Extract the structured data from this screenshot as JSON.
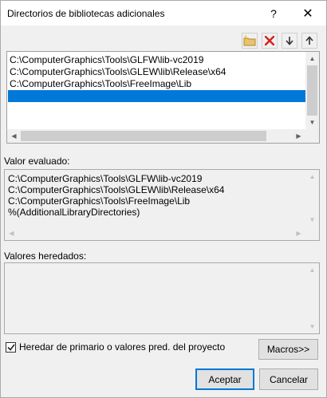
{
  "window": {
    "title": "Directorios de bibliotecas adicionales",
    "help_glyph": "?",
    "close_glyph": "✕"
  },
  "toolbar": {
    "icons": [
      "new-folder-icon",
      "delete-icon",
      "move-down-icon",
      "move-up-icon"
    ]
  },
  "list": {
    "items": [
      "C:\\ComputerGraphics\\Tools\\GLFW\\lib-vc2019",
      "C:\\ComputerGraphics\\Tools\\GLEW\\lib\\Release\\x64",
      "C:\\ComputerGraphics\\Tools\\FreeImage\\Lib",
      ""
    ],
    "selected_index": 3
  },
  "evaluated": {
    "label": "Valor evaluado:",
    "lines": [
      "C:\\ComputerGraphics\\Tools\\GLFW\\lib-vc2019",
      "C:\\ComputerGraphics\\Tools\\GLEW\\lib\\Release\\x64",
      "C:\\ComputerGraphics\\Tools\\FreeImage\\Lib",
      "%(AdditionalLibraryDirectories)"
    ]
  },
  "inherited": {
    "label": "Valores heredados:",
    "lines": []
  },
  "inherit_checkbox": {
    "label": "Heredar de primario o valores pred. del proyecto",
    "checked": true
  },
  "buttons": {
    "macros": "Macros>>",
    "ok": "Aceptar",
    "cancel": "Cancelar"
  },
  "colors": {
    "selection": "#0078d7",
    "dialog_bg": "#f0f0f0"
  }
}
